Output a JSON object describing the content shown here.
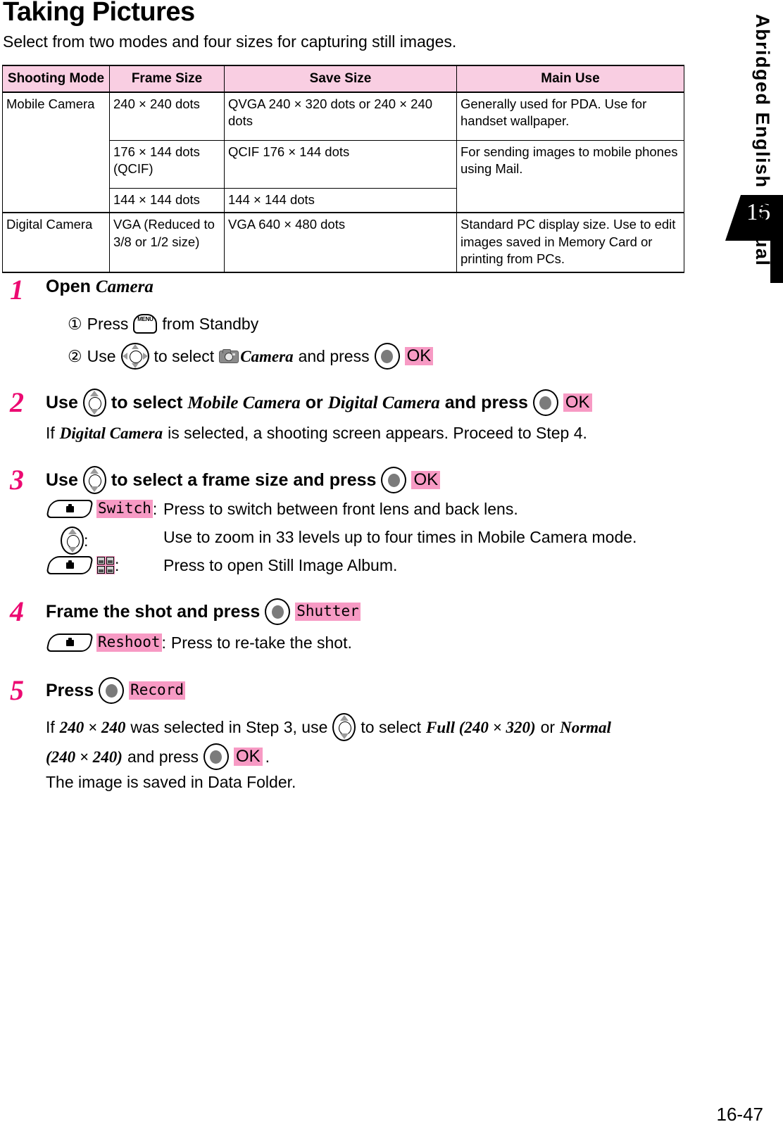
{
  "document": {
    "title": "Taking Pictures",
    "intro": "Select from two modes and four sizes for capturing still images.",
    "page_number": "16-47"
  },
  "side_tab": {
    "chapter_number": "16",
    "label": "Abridged English Manual"
  },
  "colors": {
    "header_pink": "#F9CEE2",
    "chip_pink": "#F79AC4",
    "step_number_magenta": "#EC0A72",
    "tab_black": "#000000"
  },
  "table": {
    "headers": [
      "Shooting Mode",
      "Frame Size",
      "Save Size",
      "Main Use"
    ],
    "rows": [
      {
        "mode": "Mobile Camera",
        "frame_size": "240 × 240 dots",
        "save_size": "QVGA 240 × 320 dots or 240 × 240 dots",
        "main_use": "Generally used for PDA. Use for handset wallpaper."
      },
      {
        "mode": "",
        "frame_size": "176 × 144 dots (QCIF)",
        "save_size": "QCIF 176 × 144 dots",
        "main_use": "For sending images to mobile phones using Mail."
      },
      {
        "mode": "",
        "frame_size": "144 × 144 dots",
        "save_size": "144 × 144 dots",
        "main_use": ""
      },
      {
        "mode": "Digital Camera",
        "frame_size": "VGA (Reduced to 3/8 or 1/2 size)",
        "save_size": "VGA 640 × 480 dots",
        "main_use": "Standard PC display size. Use to edit images saved in Memory Card or printing from PCs."
      }
    ]
  },
  "steps": [
    {
      "number": "1",
      "heading_before": "Open",
      "heading_emphasis": "Camera",
      "sub1_marker": "①",
      "sub1_before": "Press",
      "sub1_after": "from Standby",
      "sub2_marker": "②",
      "sub2_before": "Use",
      "sub2_mid": "to select",
      "sub2_item": "Camera",
      "sub2_and_press": "and press",
      "sub2_key_label": "OK"
    },
    {
      "number": "2",
      "head_use": "Use",
      "head_to_select": "to select",
      "head_item_1": "Mobile Camera",
      "head_or": "or",
      "head_item_2": "Digital Camera",
      "head_and_press": "and press",
      "head_key_label": "OK",
      "note": "If Digital Camera is selected, a shooting screen appears. Proceed to Step 4.",
      "note_before": "If",
      "note_emphasis": "Digital Camera",
      "note_after": "is selected, a shooting screen appears. Proceed to Step 4."
    },
    {
      "number": "3",
      "head_use": "Use",
      "head_rest": "to select a frame size and press",
      "head_key_label": "OK",
      "lines": [
        {
          "chip": "Switch",
          "colon": ":",
          "text": "Press to switch between front lens and back lens."
        },
        {
          "chip": "",
          "colon": ":",
          "text": "Use to zoom in 33 levels up to four times in Mobile Camera mode."
        },
        {
          "chip": "",
          "colon": ":",
          "text": "Press to open Still Image Album."
        }
      ]
    },
    {
      "number": "4",
      "head_before": "Frame the shot and press",
      "head_key_label": "Shutter",
      "line_chip": "Reshoot",
      "line_colon": ":",
      "line_text": "Press to re-take the shot."
    },
    {
      "number": "5",
      "head_before": "Press",
      "head_key_label": "Record",
      "note_a1": "If",
      "note_a2": "240 × 240",
      "note_a3": "was selected in Step 3, use",
      "note_a4": "to select",
      "note_a5": "Full (240 × 320)",
      "note_a6": "or",
      "note_a7": "Normal",
      "note_b1": "(240 × 240)",
      "note_b2": "and press",
      "note_b3": "OK",
      "note_b4": ".",
      "note_c": "The image is saved in Data Folder."
    }
  ]
}
